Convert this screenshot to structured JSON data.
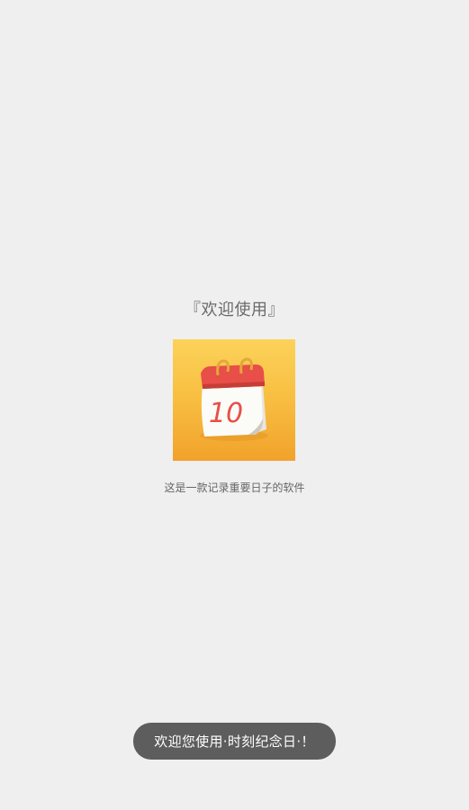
{
  "welcome": {
    "title": "『欢迎使用』",
    "subtitle": "这是一款记录重要日子的软件"
  },
  "app_icon": {
    "icon_name": "calendar-icon",
    "date_number": "10",
    "colors": {
      "background_top": "#fcd25a",
      "background_bottom": "#f2a22b",
      "calendar_header": "#e84f48",
      "date_text": "#e84f48"
    }
  },
  "toast": {
    "message": "欢迎您使用·时刻纪念日·！"
  }
}
